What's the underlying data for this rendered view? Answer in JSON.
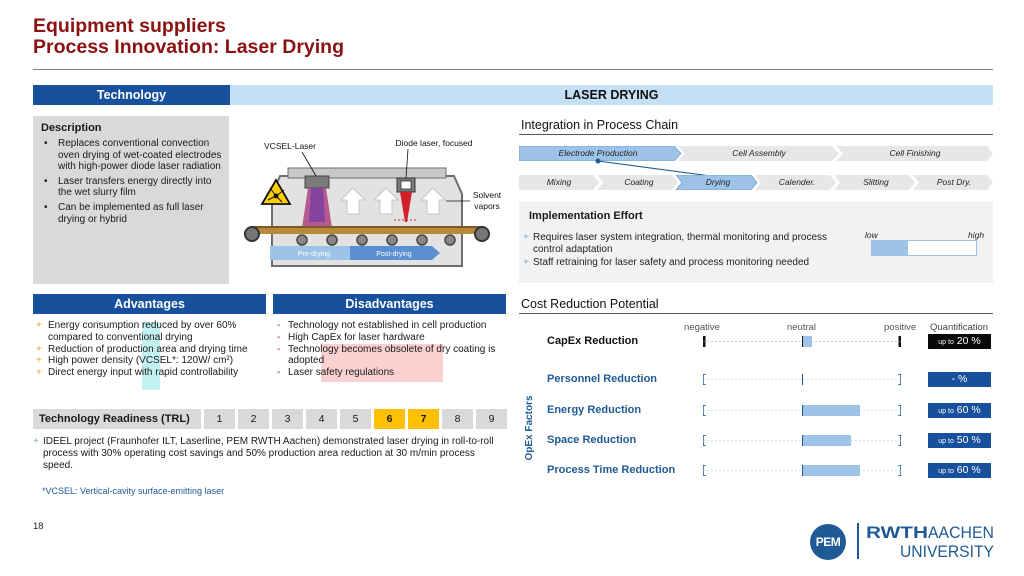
{
  "title": {
    "line1": "Equipment suppliers",
    "line2": "Process Innovation: Laser Drying"
  },
  "header": {
    "technology": "Technology",
    "laser_drying": "LASER DRYING"
  },
  "description": {
    "title": "Description",
    "bullets": [
      "Replaces conventional convection oven drying of wet-coated electrodes with high-power diode laser radiation",
      "Laser transfers energy directly into the wet slurry film",
      "Can be implemented as full laser drying or hybrid"
    ]
  },
  "illustration": {
    "vcsel_label": "VCSEL-Laser",
    "diode_label": "Diode laser, focused",
    "solvent_label_1": "Solvent",
    "solvent_label_2": "vapors",
    "pre_drying": "Pre-drying",
    "post_drying": "Post-drying"
  },
  "process_chain": {
    "title": "Integration in Process Chain",
    "main": [
      "Electrode Production",
      "Cell Assembly",
      "Cell Finishing"
    ],
    "steps": [
      "Mixing",
      "Coating",
      "Drying",
      "Calender.",
      "Slitting",
      "Post Dry."
    ],
    "active_main": "Electrode Production",
    "active_step": "Drying"
  },
  "implementation": {
    "title": "Implementation Effort",
    "bullets": [
      "Requires laser system integration, thermal monitoring and process control adaptation",
      "Staff retraining for laser safety and process monitoring needed"
    ],
    "low": "low",
    "high": "high",
    "level": 0.35
  },
  "advantages": {
    "title": "Advantages",
    "items": [
      "Energy consumption reduced by over 60% compared to conventional drying",
      "Reduction of production area and drying time",
      "High power density (VCSEL*: 120W/ cm²)",
      "Direct energy input with rapid controllability"
    ]
  },
  "disadvantages": {
    "title": "Disadvantages",
    "items": [
      "Technology not established in cell production",
      "High CapEx for laser hardware",
      "Technology becomes obsolete of dry coating is adopted",
      "Laser safety regulations"
    ]
  },
  "trl": {
    "label": "Technology Readiness (TRL)",
    "levels": [
      "1",
      "2",
      "3",
      "4",
      "5",
      "6",
      "7",
      "8",
      "9"
    ],
    "active": [
      "6",
      "7"
    ],
    "note": "IDEEL project (Fraunhofer ILT, Laserline, PEM RWTH Aachen) demonstrated laser drying in roll-to-roll process with 30% operating cost savings and 50% production area reduction at 30 m/min process speed."
  },
  "footnote": "*VCSEL: Vertical-cavity surface-emitting laser",
  "cost_reduction": {
    "title": "Cost Reduction Potential",
    "axis": {
      "negative": "negative",
      "neutral": "neutral",
      "positive": "positive",
      "quantification": "Quantification"
    },
    "opex_label": "OpEx Factors",
    "capex": {
      "label": "CapEx Reduction",
      "prefix": "up to",
      "value": "20 %",
      "level": 0.1
    },
    "opex": [
      {
        "label": "Personnel Reduction",
        "prefix": "",
        "value": "- %",
        "level": 0.0
      },
      {
        "label": "Energy Reduction",
        "prefix": "up to",
        "value": "60 %",
        "level": 0.6
      },
      {
        "label": "Space Reduction",
        "prefix": "up to",
        "value": "50 %",
        "level": 0.5
      },
      {
        "label": "Process Time Reduction",
        "prefix": "up to",
        "value": "60 %",
        "level": 0.6
      }
    ]
  },
  "footer": {
    "page_number": "18",
    "pem": "PEM",
    "rwth_1": "RWTH",
    "rwth_2": "AACHEN",
    "rwth_3": "UNIVERSITY"
  },
  "colors": {
    "title_red": "#8b1212",
    "header_blue": "#17509c",
    "header_light": "#c5dff4",
    "accent_orange": "#ffc000",
    "bar_fill": "#9dc3e6"
  }
}
